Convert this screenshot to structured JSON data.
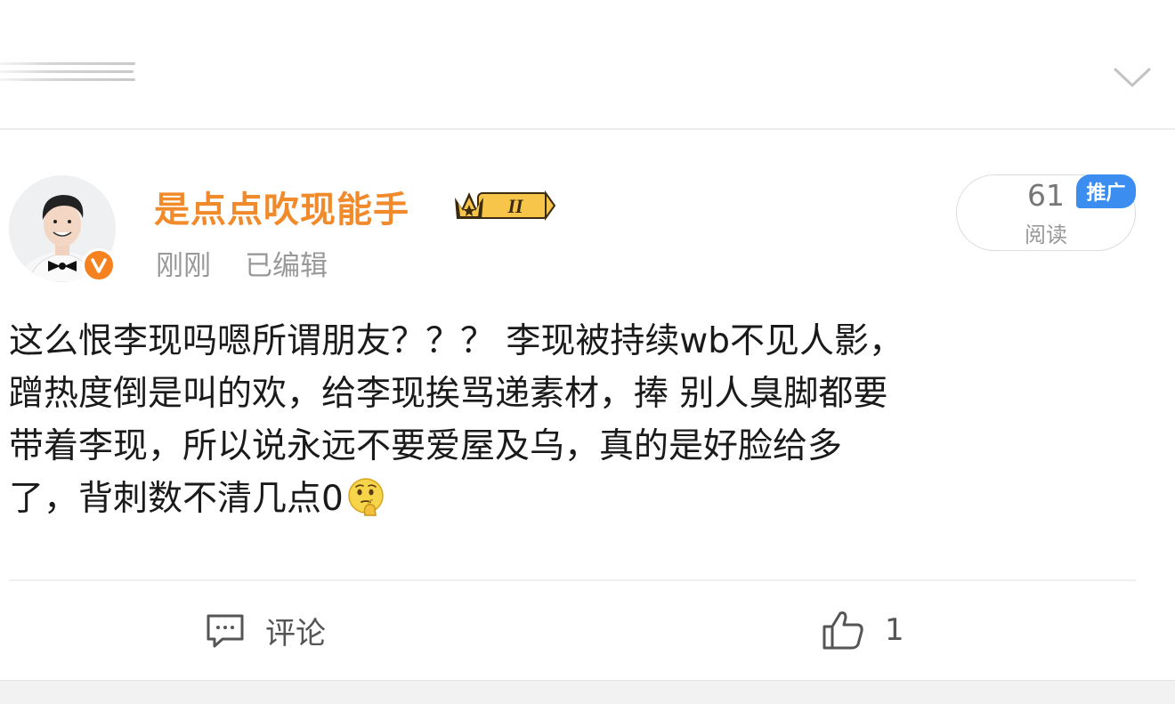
{
  "header": {
    "menu_icon": "menu-lines-icon",
    "expand_icon": "chevron-down-icon"
  },
  "post": {
    "author": {
      "name": "是点点吹现能手",
      "avatar_icon": "user-avatar",
      "verified_icon": "verified-v-badge-icon",
      "level_badge_text": "II"
    },
    "meta": {
      "time": "刚刚",
      "edited": "已编辑"
    },
    "reads": {
      "count": "61",
      "label": "阅读",
      "promo_tag": "推广"
    },
    "content_lines": [
      "这么恨李现吗嗯所谓朋友？？？ 李现被持续wb不见人影，",
      "蹭热度倒是叫的欢，给李现挨骂递素材，捧 别人臭脚都要",
      "带着李现，所以说永远不要爱屋及乌，真的是好脸给多",
      "了，背刺数不清几点0"
    ],
    "actions": {
      "comment_label": "评论",
      "like_count": "1"
    }
  },
  "colors": {
    "username": "#f08a2b",
    "verified": "#f5821f",
    "promo": "#3b8ef0",
    "accent": "#4a8fe0"
  }
}
